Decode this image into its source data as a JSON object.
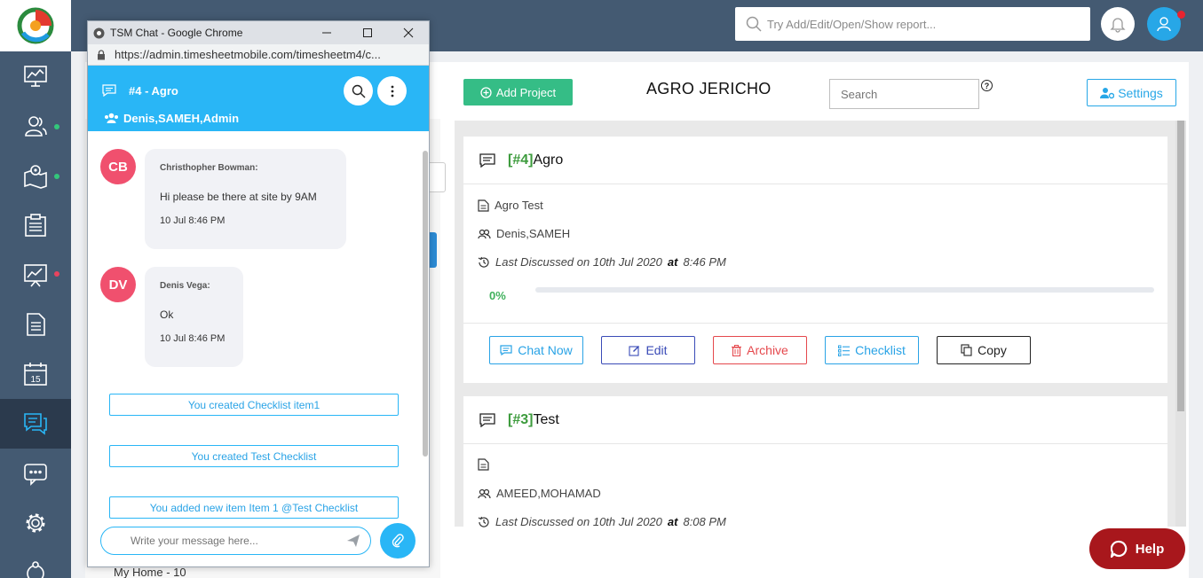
{
  "topbar": {
    "search_placeholder": "Try Add/Edit/Open/Show report..."
  },
  "sidebar": {
    "items": [
      {
        "icon": "dashboard-icon"
      },
      {
        "icon": "users-icon",
        "dot": "#33c77b"
      },
      {
        "icon": "map-location-icon",
        "dot": "#33c77b"
      },
      {
        "icon": "clipboard-icon"
      },
      {
        "icon": "reports-chart-icon",
        "dot": "#e8435e"
      },
      {
        "icon": "document-icon"
      },
      {
        "icon": "calendar-icon",
        "calendar_day": "15"
      },
      {
        "icon": "chat-icon",
        "active": true
      },
      {
        "icon": "message-dots-icon"
      },
      {
        "icon": "gear-icon"
      },
      {
        "icon": "network-icon"
      }
    ]
  },
  "page": {
    "add_project_label": "Add Project",
    "title": "AGRO JERICHO",
    "search_placeholder": "Search",
    "help_mark": "?",
    "settings_label": "Settings",
    "left_bottom_text": "My Home - 10"
  },
  "cards": [
    {
      "num": "[#4]",
      "name": "Agro",
      "description": "Agro Test",
      "members": "Denis,SAMEH",
      "last_discussed_prefix": "Last Discussed on 10th Jul 2020",
      "at_word": "at",
      "last_discussed_time": "8:46 PM",
      "progress_label": "0%",
      "progress_value": 0,
      "buttons": {
        "chat": "Chat Now",
        "edit": "Edit",
        "archive": "Archive",
        "checklist": "Checklist",
        "copy": "Copy"
      }
    },
    {
      "num": "[#3]",
      "name": "Test",
      "description": "",
      "members": "AMEED,MOHAMAD",
      "last_discussed_prefix": "Last Discussed on 10th Jul 2020",
      "at_word": "at",
      "last_discussed_time": "8:08 PM"
    }
  ],
  "chat_window": {
    "window_title": "TSM Chat - Google Chrome",
    "url": "https://admin.timesheetmobile.com/timesheetm4/c...",
    "chat_title": "#4 - Agro",
    "members": "Denis,SAMEH,Admin",
    "messages": [
      {
        "initials": "CB",
        "sender": "Christhopher Bowman:",
        "text": "Hi please be there at site by 9AM",
        "time": "10 Jul 8:46 PM"
      },
      {
        "initials": "DV",
        "sender": "Denis Vega:",
        "text": "Ok",
        "time": "10 Jul 8:46 PM"
      }
    ],
    "system_messages": [
      "You created Checklist item1",
      "You created Test Checklist",
      "You added new item Item 1 @Test Checklist"
    ],
    "composer_placeholder": "Write your message here..."
  },
  "help_label": "Help",
  "colors": {
    "sidebar": "#445a72",
    "accent": "#29b6f6",
    "green": "#35bd86",
    "danger": "#a8171c"
  }
}
